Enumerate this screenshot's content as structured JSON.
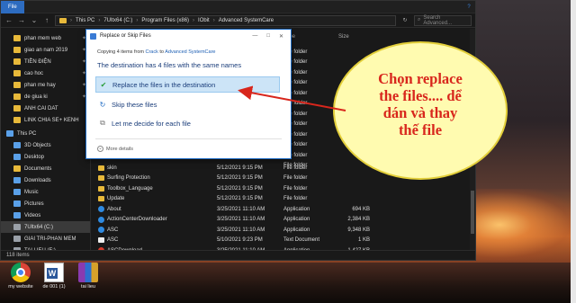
{
  "ribbon": {
    "file_tab": "File"
  },
  "address": {
    "segments": [
      "This PC",
      "7Ultx64 (C:)",
      "Program Files (x86)",
      "IObit",
      "Advanced SystemCare"
    ],
    "search_placeholder": "Search Advanced..."
  },
  "nav": {
    "quick": [
      {
        "label": "phan mem web",
        "pinned": true
      },
      {
        "label": "giao an nam 2019",
        "pinned": true
      },
      {
        "label": "TIỀN ĐIỆN",
        "pinned": true
      },
      {
        "label": "cao hoc",
        "pinned": true
      },
      {
        "label": "phan me hay",
        "pinned": true
      },
      {
        "label": "de giua ki",
        "pinned": true
      },
      {
        "label": "ANH CAI DAT",
        "pinned": false
      },
      {
        "label": "LINK CHIA SE+ KENH",
        "pinned": false
      }
    ],
    "this_pc": "This PC",
    "pc_items": [
      "3D Objects",
      "Desktop",
      "Documents",
      "Downloads",
      "Music",
      "Pictures",
      "Videos",
      "7Ultx64 (C:)",
      "GIAI TRI-PHAN MEM",
      "TAI LIEU (F:)"
    ]
  },
  "columns": {
    "name": "Name",
    "date": "Date modified",
    "type": "Type",
    "size": "Size"
  },
  "top_rows_types": [
    "File folder",
    "File folder",
    "File folder",
    "File folder",
    "File folder",
    "File folder",
    "File folder",
    "File folder",
    "File folder",
    "File folder",
    "File folder",
    "File folder"
  ],
  "rows": [
    {
      "name": "skin",
      "date": "5/12/2021 9:15 PM",
      "type": "File folder",
      "size": "",
      "kind": "folder"
    },
    {
      "name": "Surfing Protection",
      "date": "5/12/2021 9:15 PM",
      "type": "File folder",
      "size": "",
      "kind": "folder"
    },
    {
      "name": "Toolbox_Language",
      "date": "5/12/2021 9:15 PM",
      "type": "File folder",
      "size": "",
      "kind": "folder"
    },
    {
      "name": "Update",
      "date": "5/12/2021 9:15 PM",
      "type": "File folder",
      "size": "",
      "kind": "folder"
    },
    {
      "name": "About",
      "date": "3/25/2021 11:10 AM",
      "type": "Application",
      "size": "694 KB",
      "kind": "app"
    },
    {
      "name": "ActionCenterDownloader",
      "date": "3/25/2021 11:10 AM",
      "type": "Application",
      "size": "2,384 KB",
      "kind": "app"
    },
    {
      "name": "ASC",
      "date": "3/25/2021 11:10 AM",
      "type": "Application",
      "size": "9,348 KB",
      "kind": "app"
    },
    {
      "name": "ASC",
      "date": "5/10/2021 9:23 PM",
      "type": "Text Document",
      "size": "1 KB",
      "kind": "doc"
    },
    {
      "name": "ASCDownload",
      "date": "3/25/2021 11:10 AM",
      "type": "Application",
      "size": "1,427 KB",
      "kind": "app"
    }
  ],
  "status": {
    "items": "118 items"
  },
  "dialog": {
    "title": "Replace or Skip Files",
    "copying_prefix": "Copying 4 items from",
    "from": "Crack",
    "to_word": "to",
    "to": "Advanced SystemCare",
    "heading": "The destination has 4 files with the same names",
    "options": [
      {
        "label": "Replace the files in the destination",
        "icon": "check-icon"
      },
      {
        "label": "Skip these files",
        "icon": "skip-icon"
      },
      {
        "label": "Let me decide for each file",
        "icon": "decide-icon"
      }
    ],
    "more_details": "More details"
  },
  "callout": {
    "lines": [
      "Chọn replace",
      "the files.... dể",
      "dán và thay",
      "thế file"
    ],
    "fill": "#fffbb0",
    "text_color": "#d8261c"
  },
  "taskbar": [
    {
      "label": "my website",
      "icon": "chrome-icon"
    },
    {
      "label": "de 001 (1)",
      "icon": "word-doc-icon"
    },
    {
      "label": "tai lieu",
      "icon": "winrar-icon"
    }
  ]
}
